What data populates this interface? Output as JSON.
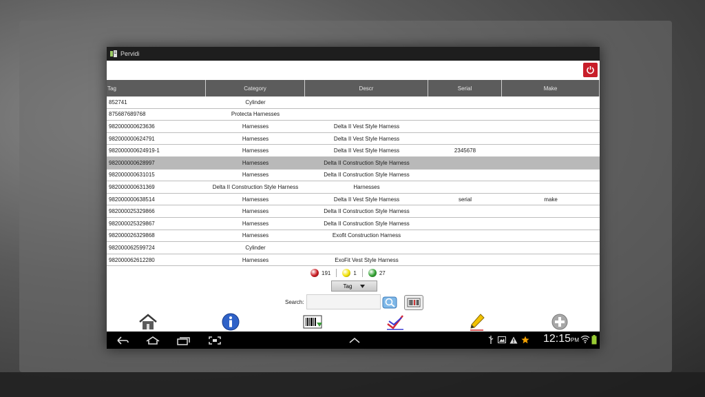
{
  "app": {
    "title": "Pervidi"
  },
  "table": {
    "columns": [
      "Tag",
      "Category",
      "Descr",
      "Serial",
      "Make"
    ],
    "rows": [
      {
        "tag": "852741",
        "category": "Cylinder",
        "descr": "",
        "serial": "",
        "make": ""
      },
      {
        "tag": "875687689768",
        "category": "Protecta Harnesses",
        "descr": "",
        "serial": "",
        "make": ""
      },
      {
        "tag": "982000000623636",
        "category": "Harnesses",
        "descr": "Delta II Vest Style Harness",
        "serial": "",
        "make": ""
      },
      {
        "tag": "982000000624791",
        "category": "Harnesses",
        "descr": "Delta II Vest Style Harness",
        "serial": "",
        "make": ""
      },
      {
        "tag": "982000000624919-1",
        "category": "Harnesses",
        "descr": "Delta II Vest Style Harness",
        "serial": "2345678",
        "make": ""
      },
      {
        "tag": "982000000628997",
        "category": "Harnesses",
        "descr": "Delta II Construction Style Harness",
        "serial": "",
        "make": "",
        "selected": true
      },
      {
        "tag": "982000000631015",
        "category": "Harnesses",
        "descr": "Delta II Construction Style Harness",
        "serial": "",
        "make": ""
      },
      {
        "tag": "982000000631369",
        "category": "Delta II Construction Style Harness",
        "descr": "Harnesses",
        "serial": "",
        "make": ""
      },
      {
        "tag": "982000000638514",
        "category": "Harnesses",
        "descr": "Delta II Vest Style Harness",
        "serial": "serial",
        "make": "make"
      },
      {
        "tag": "982000025329866",
        "category": "Harnesses",
        "descr": "Delta II Construction Style Harness",
        "serial": "",
        "make": ""
      },
      {
        "tag": "982000025329867",
        "category": "Harnesses",
        "descr": "Delta II Construction Style Harness",
        "serial": "",
        "make": ""
      },
      {
        "tag": "982000026329868",
        "category": "Harnesses",
        "descr": "Exofit Construction Harness",
        "serial": "",
        "make": ""
      },
      {
        "tag": "982000062599724",
        "category": "Cylinder",
        "descr": "",
        "serial": "",
        "make": ""
      },
      {
        "tag": "982000062612280",
        "category": "Harnesses",
        "descr": "ExoFit Vest Style Harness",
        "serial": "",
        "make": ""
      }
    ]
  },
  "status_counts": [
    {
      "color": "#c8161d",
      "count": "191"
    },
    {
      "color": "#f2e200",
      "count": "1"
    },
    {
      "color": "#2ea02e",
      "count": "27"
    }
  ],
  "sort": {
    "selected": "Tag"
  },
  "search": {
    "label": "Search:",
    "value": ""
  },
  "statusbar": {
    "time": "12:15",
    "ampm": "PM"
  },
  "colors": {
    "header_bg": "#5c5c5c",
    "selected_row": "#b9b9b9",
    "power_button": "#c81e2a"
  }
}
